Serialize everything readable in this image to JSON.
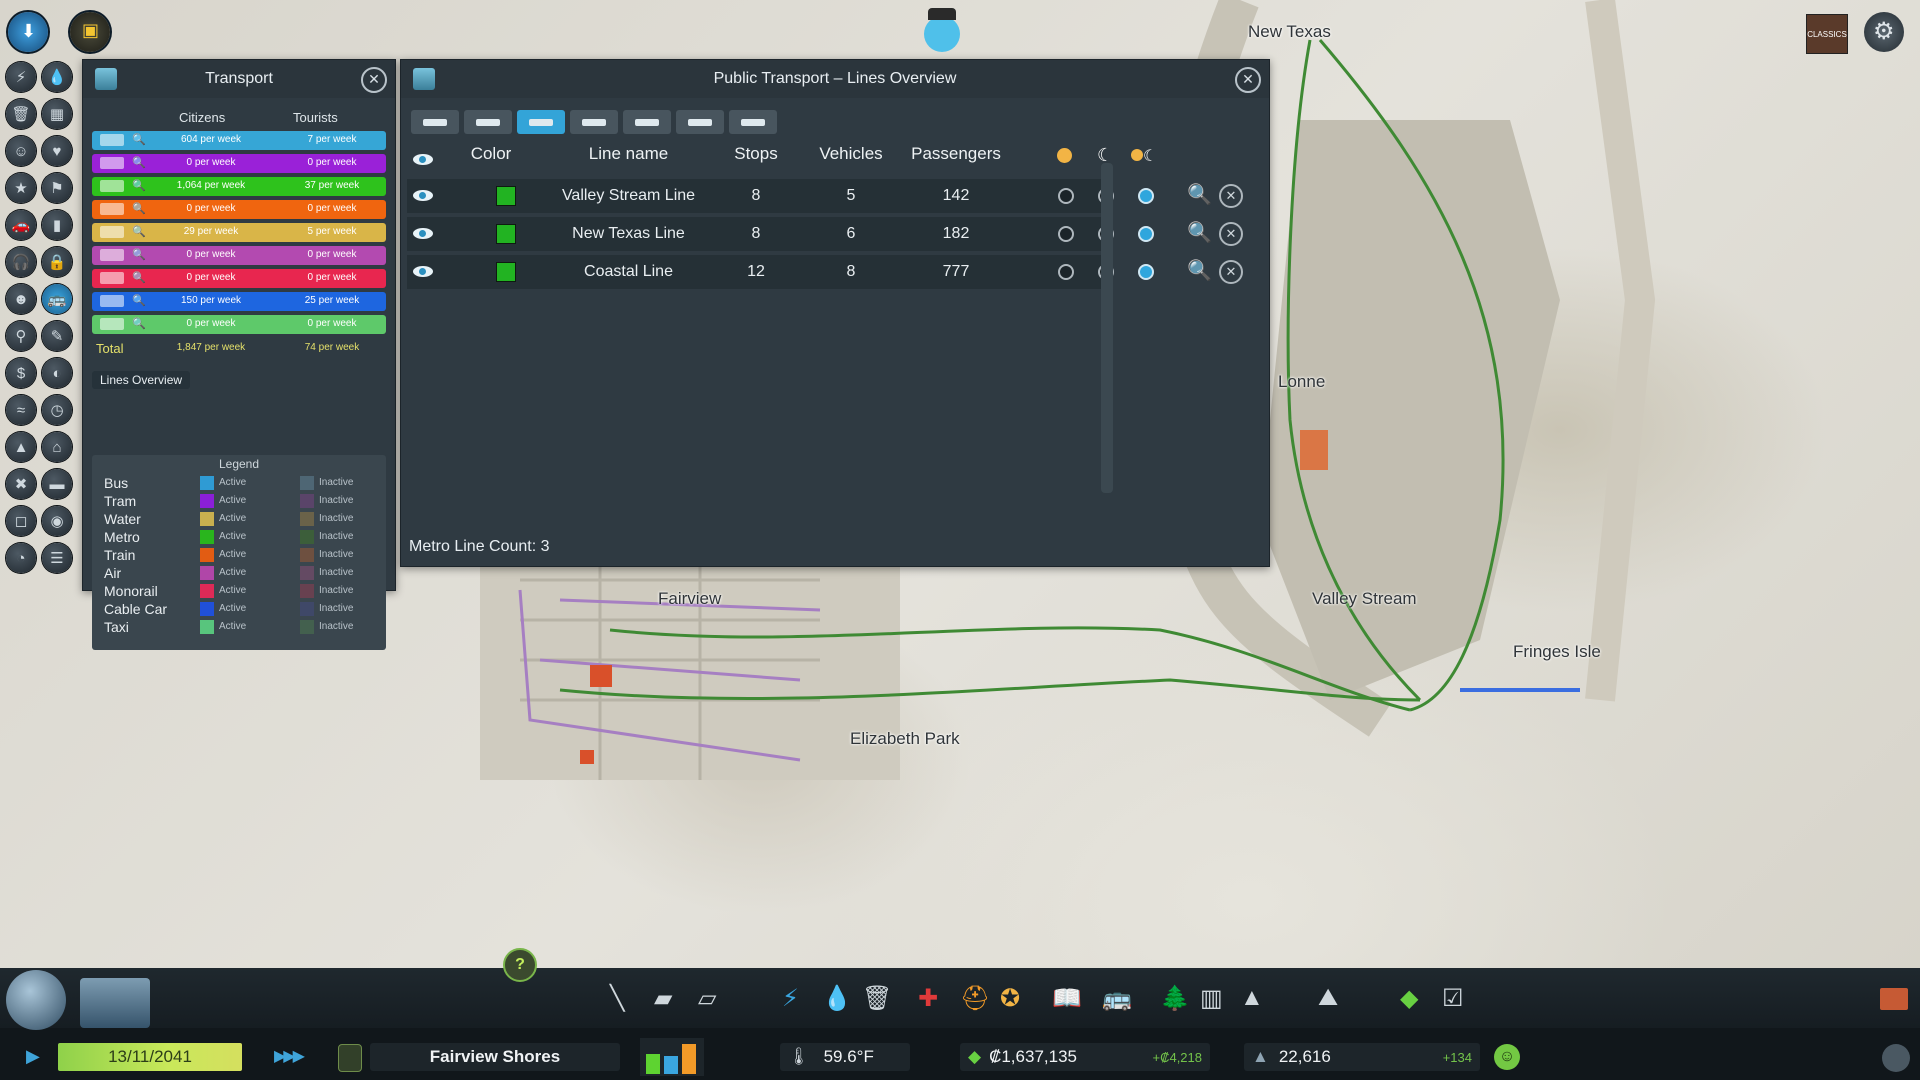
{
  "top_left_buttons": [
    {
      "icon": "arrow-down-blue-icon"
    },
    {
      "icon": "roadblock-icon"
    }
  ],
  "chirper_icon": "chirper-bird-icon",
  "top_right": {
    "dlc_icon": "radio-classics-icon",
    "settings_icon": "gear-icon",
    "dlc_label": "CLASSICS"
  },
  "map_labels": [
    {
      "id": "new-texas",
      "text": "New Texas"
    },
    {
      "id": "lonne",
      "text": "Lonne"
    },
    {
      "id": "valley-stream",
      "text": "Valley Stream"
    },
    {
      "id": "fringes-isle",
      "text": "Fringes Isle"
    },
    {
      "id": "fairview",
      "text": "Fairview"
    },
    {
      "id": "elizabeth-park",
      "text": "Elizabeth Park"
    }
  ],
  "transport_panel": {
    "title": "Transport",
    "col_citizens": "Citizens",
    "col_tourists": "Tourists",
    "rows": [
      {
        "type": "bus",
        "citizens": "604 per week",
        "tourists": "7 per week",
        "color": "#36a6d6"
      },
      {
        "type": "tram",
        "citizens": "0 per week",
        "tourists": "0 per week",
        "color": "#9a21d8"
      },
      {
        "type": "metro",
        "citizens": "1,064 per week",
        "tourists": "37 per week",
        "color": "#2ec21c"
      },
      {
        "type": "train",
        "citizens": "0 per week",
        "tourists": "0 per week",
        "color": "#f0650f"
      },
      {
        "type": "ship",
        "citizens": "29 per week",
        "tourists": "5 per week",
        "color": "#d9b548"
      },
      {
        "type": "plane",
        "citizens": "0 per week",
        "tourists": "0 per week",
        "color": "#b34ab0"
      },
      {
        "type": "monorail",
        "citizens": "0 per week",
        "tourists": "0 per week",
        "color": "#e8264f"
      },
      {
        "type": "cable-car",
        "citizens": "150 per week",
        "tourists": "25 per week",
        "color": "#1e66e0"
      },
      {
        "type": "taxi",
        "citizens": "0 per week",
        "tourists": "0 per week",
        "color": "#5ec96a"
      }
    ],
    "total_label": "Total",
    "total_citizens": "1,847 per week",
    "total_tourists": "74 per week",
    "lines_overview_button": "Lines Overview",
    "legend_title": "Legend",
    "legend": [
      {
        "name": "Bus",
        "active": "Active",
        "inactive": "Inactive",
        "active_color": "#2f9bd4",
        "inactive_color": "#4e6674"
      },
      {
        "name": "Tram",
        "active": "Active",
        "inactive": "Inactive",
        "active_color": "#8b1fd8",
        "inactive_color": "#5a4469"
      },
      {
        "name": "Water",
        "active": "Active",
        "inactive": "Inactive",
        "active_color": "#c9b04f",
        "inactive_color": "#6a6249"
      },
      {
        "name": "Metro",
        "active": "Active",
        "inactive": "Inactive",
        "active_color": "#29b51d",
        "inactive_color": "#3c5e3a"
      },
      {
        "name": "Train",
        "active": "Active",
        "inactive": "Inactive",
        "active_color": "#e25c13",
        "inactive_color": "#6e5040"
      },
      {
        "name": "Air",
        "active": "Active",
        "inactive": "Inactive",
        "active_color": "#b046a8",
        "inactive_color": "#644a63"
      },
      {
        "name": "Monorail",
        "active": "Active",
        "inactive": "Inactive",
        "active_color": "#de2a57",
        "inactive_color": "#684150"
      },
      {
        "name": "Cable Car",
        "active": "Active",
        "inactive": "Inactive",
        "active_color": "#2050d9",
        "inactive_color": "#3f4868"
      },
      {
        "name": "Taxi",
        "active": "Active",
        "inactive": "Inactive",
        "active_color": "#58c57d",
        "inactive_color": "#43604e"
      }
    ]
  },
  "lines_panel": {
    "title": "Public Transport – Lines Overview",
    "tabs": [
      {
        "type": "bus",
        "active": false
      },
      {
        "type": "tram",
        "active": false
      },
      {
        "type": "metro",
        "active": true
      },
      {
        "type": "train",
        "active": false
      },
      {
        "type": "ship",
        "active": false
      },
      {
        "type": "plane",
        "active": false
      },
      {
        "type": "monorail",
        "active": false
      }
    ],
    "headers": {
      "color": "Color",
      "name": "Line name",
      "stops": "Stops",
      "vehicles": "Vehicles",
      "passengers": "Passengers"
    },
    "lines": [
      {
        "name": "Valley Stream Line",
        "stops": "8",
        "vehicles": "5",
        "passengers": "142",
        "color": "#22b322",
        "schedule": "day-and-night"
      },
      {
        "name": "New Texas Line",
        "stops": "8",
        "vehicles": "6",
        "passengers": "182",
        "color": "#22b322",
        "schedule": "day-and-night"
      },
      {
        "name": "Coastal Line",
        "stops": "12",
        "vehicles": "8",
        "passengers": "777",
        "color": "#22b322",
        "schedule": "day-and-night"
      }
    ],
    "footer": "Metro Line Count: 3"
  },
  "bottom": {
    "date": "13/11/2041",
    "city_name": "Fairview Shores",
    "temperature": "59.6°F",
    "money": "₡1,637,135",
    "income": "+₡4,218",
    "population": "22,616",
    "population_change": "+134",
    "toolbar_icons": [
      "roads-icon",
      "zoning-icon",
      "districts-icon",
      "electricity-icon",
      "water-icon",
      "garbage-icon",
      "healthcare-icon",
      "fire-icon",
      "police-icon",
      "education-icon",
      "public-transport-icon",
      "parks-icon",
      "unique-buildings-icon",
      "monuments-icon",
      "landscaping-icon",
      "money-icon",
      "policies-icon"
    ]
  }
}
